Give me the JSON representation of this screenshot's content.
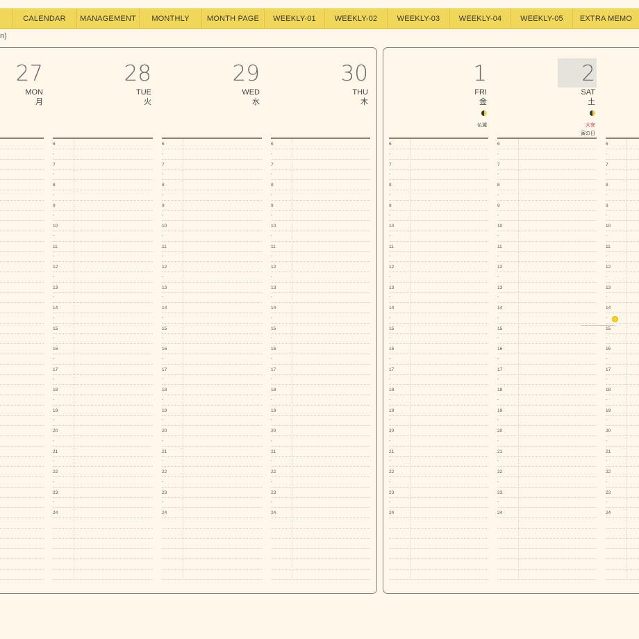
{
  "tabs": [
    "CALENDAR",
    "MANAGEMENT",
    "MONTHLY",
    "MONTH PAGE",
    "WEEKLY-01",
    "WEEKLY-02",
    "WEEKLY-03",
    "WEEKLY-04",
    "WEEKLY-05",
    "EXTRA MEMO"
  ],
  "subtitle": "n)",
  "days": [
    {
      "num": "27",
      "name": "MON",
      "kanji": "月"
    },
    {
      "num": "28",
      "name": "TUE",
      "kanji": "火"
    },
    {
      "num": "29",
      "name": "WED",
      "kanji": "水"
    },
    {
      "num": "30",
      "name": "THU",
      "kanji": "木"
    },
    {
      "num": "1",
      "name": "FRI",
      "kanji": "金",
      "rokuyo": "仏滅"
    },
    {
      "num": "2",
      "name": "SAT",
      "kanji": "土",
      "rokuyo": "大安",
      "extra": "寅の日"
    }
  ],
  "hours": [
    "6",
    "7",
    "8",
    "9",
    "10",
    "11",
    "12",
    "13",
    "14",
    "15",
    "16",
    "17",
    "18",
    "19",
    "20",
    "21",
    "22",
    "23",
    "24"
  ],
  "half_mark": "-",
  "colors": {
    "tab_bar": "#f0d75a",
    "paper": "#fff7ea",
    "border": "#8c8070",
    "rokuyo_red": "#e2384a",
    "event_dot": "#f5d320"
  }
}
